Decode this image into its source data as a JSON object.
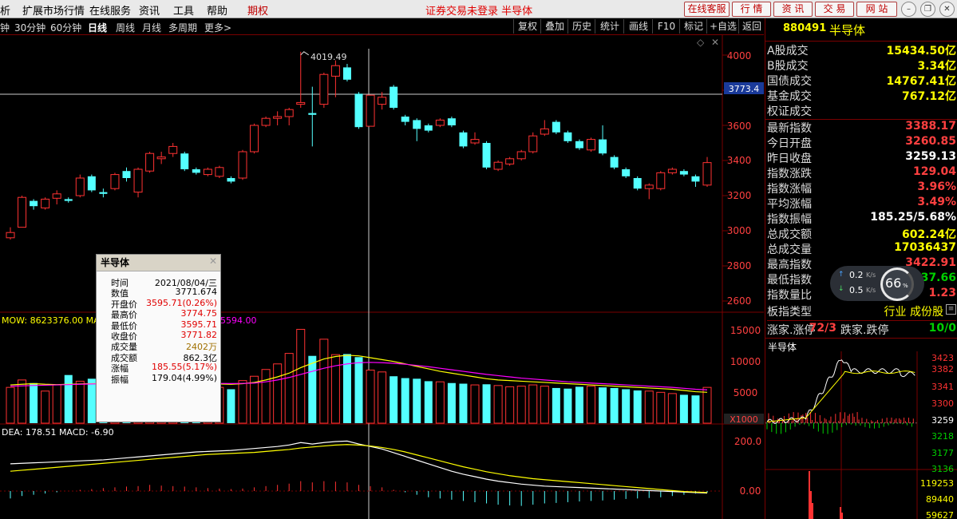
{
  "menu": {
    "items": [
      "析",
      "扩展市场行情",
      "在线服务",
      "资讯",
      "工具",
      "帮助",
      "期权"
    ],
    "status": "证券交易未登录 半导体",
    "buttons": [
      "在线客服",
      "行 情",
      "资 讯",
      "交 易",
      "网 站"
    ]
  },
  "periods": [
    "钟",
    "30分钟",
    "60分钟",
    "日线",
    "周线",
    "月线",
    "多周期",
    "更多>"
  ],
  "selected_period": "日线",
  "tools": [
    "复权",
    "叠加",
    "历史",
    "统计",
    "画线",
    "F10",
    "标记",
    "+自选",
    "返回"
  ],
  "chart": {
    "price_axis": [
      "4000",
      "3800",
      "3600",
      "3400",
      "3200",
      "3000",
      "2800",
      "2600"
    ],
    "crosshair_price": "3773.4",
    "high_marker": "4019.49",
    "vol_axis": [
      "15000",
      "10000",
      "5000"
    ],
    "vol_unit": "X1000",
    "vol_legend": "MOW: 8623376.00  MA",
    "vol_legend_tail": "5594.00",
    "macd_legend": "DEA: 178.51  MACD: -6.90",
    "macd_axis": [
      "200.0",
      "0.00"
    ],
    "colors": {
      "up": "#ff3232",
      "down": "#54ffff",
      "ma1": "#ffffff",
      "ma2": "#ffff00",
      "ma3": "#ff00ff"
    }
  },
  "chart_data": {
    "type": "candlestick",
    "title": "880491 半导体",
    "ylim": [
      2560,
      4080
    ],
    "candles": [
      {
        "o": 2960,
        "c": 2990,
        "h": 3020,
        "l": 2950
      },
      {
        "o": 3020,
        "c": 3190,
        "h": 3200,
        "l": 3020
      },
      {
        "o": 3170,
        "c": 3140,
        "h": 3180,
        "l": 3120
      },
      {
        "o": 3130,
        "c": 3180,
        "h": 3190,
        "l": 3120
      },
      {
        "o": 3185,
        "c": 3210,
        "h": 3230,
        "l": 3150
      },
      {
        "o": 3180,
        "c": 3170,
        "h": 3190,
        "l": 3160
      },
      {
        "o": 3200,
        "c": 3300,
        "h": 3320,
        "l": 3190
      },
      {
        "o": 3310,
        "c": 3230,
        "h": 3320,
        "l": 3220
      },
      {
        "o": 3220,
        "c": 3210,
        "h": 3240,
        "l": 3190
      },
      {
        "o": 3240,
        "c": 3320,
        "h": 3330,
        "l": 3230
      },
      {
        "o": 3340,
        "c": 3300,
        "h": 3360,
        "l": 3280
      },
      {
        "o": 3220,
        "c": 3350,
        "h": 3360,
        "l": 3190
      },
      {
        "o": 3340,
        "c": 3440,
        "h": 3450,
        "l": 3330
      },
      {
        "o": 3410,
        "c": 3420,
        "h": 3450,
        "l": 3380
      },
      {
        "o": 3440,
        "c": 3480,
        "h": 3500,
        "l": 3420
      },
      {
        "o": 3440,
        "c": 3350,
        "h": 3450,
        "l": 3340
      },
      {
        "o": 3350,
        "c": 3330,
        "h": 3360,
        "l": 3320
      },
      {
        "o": 3320,
        "c": 3350,
        "h": 3360,
        "l": 3310
      },
      {
        "o": 3310,
        "c": 3360,
        "h": 3370,
        "l": 3300
      },
      {
        "o": 3300,
        "c": 3280,
        "h": 3310,
        "l": 3270
      },
      {
        "o": 3300,
        "c": 3450,
        "h": 3460,
        "l": 3290
      },
      {
        "o": 3450,
        "c": 3600,
        "h": 3610,
        "l": 3440
      },
      {
        "o": 3600,
        "c": 3640,
        "h": 3650,
        "l": 3590
      },
      {
        "o": 3640,
        "c": 3650,
        "h": 3680,
        "l": 3600
      },
      {
        "o": 3650,
        "c": 3690,
        "h": 3700,
        "l": 3600
      },
      {
        "o": 3720,
        "c": 3730,
        "h": 4019,
        "l": 3700
      },
      {
        "o": 3670,
        "c": 3660,
        "h": 3820,
        "l": 3480
      },
      {
        "o": 3720,
        "c": 3890,
        "h": 3900,
        "l": 3700
      },
      {
        "o": 3880,
        "c": 3940,
        "h": 3970,
        "l": 3760
      },
      {
        "o": 3930,
        "c": 3860,
        "h": 3950,
        "l": 3850
      },
      {
        "o": 3780,
        "c": 3590,
        "h": 3790,
        "l": 3580
      },
      {
        "o": 3595,
        "c": 3772,
        "h": 3775,
        "l": 3596
      },
      {
        "o": 3720,
        "c": 3760,
        "h": 3790,
        "l": 3690
      },
      {
        "o": 3820,
        "c": 3700,
        "h": 3830,
        "l": 3690
      },
      {
        "o": 3650,
        "c": 3620,
        "h": 3660,
        "l": 3600
      },
      {
        "o": 3630,
        "c": 3580,
        "h": 3640,
        "l": 3510
      },
      {
        "o": 3600,
        "c": 3570,
        "h": 3610,
        "l": 3560
      },
      {
        "o": 3600,
        "c": 3630,
        "h": 3640,
        "l": 3590
      },
      {
        "o": 3640,
        "c": 3600,
        "h": 3650,
        "l": 3590
      },
      {
        "o": 3560,
        "c": 3480,
        "h": 3570,
        "l": 3470
      },
      {
        "o": 3500,
        "c": 3520,
        "h": 3560,
        "l": 3490
      },
      {
        "o": 3500,
        "c": 3360,
        "h": 3510,
        "l": 3350
      },
      {
        "o": 3350,
        "c": 3390,
        "h": 3400,
        "l": 3340
      },
      {
        "o": 3380,
        "c": 3410,
        "h": 3420,
        "l": 3370
      },
      {
        "o": 3410,
        "c": 3450,
        "h": 3460,
        "l": 3400
      },
      {
        "o": 3450,
        "c": 3540,
        "h": 3560,
        "l": 3440
      },
      {
        "o": 3550,
        "c": 3580,
        "h": 3630,
        "l": 3540
      },
      {
        "o": 3620,
        "c": 3560,
        "h": 3630,
        "l": 3550
      },
      {
        "o": 3560,
        "c": 3510,
        "h": 3570,
        "l": 3500
      },
      {
        "o": 3510,
        "c": 3470,
        "h": 3520,
        "l": 3460
      },
      {
        "o": 3460,
        "c": 3520,
        "h": 3530,
        "l": 3450
      },
      {
        "o": 3520,
        "c": 3440,
        "h": 3600,
        "l": 3430
      },
      {
        "o": 3420,
        "c": 3360,
        "h": 3430,
        "l": 3350
      },
      {
        "o": 3350,
        "c": 3310,
        "h": 3360,
        "l": 3300
      },
      {
        "o": 3300,
        "c": 3240,
        "h": 3310,
        "l": 3230
      },
      {
        "o": 3240,
        "c": 3260,
        "h": 3270,
        "l": 3180
      },
      {
        "o": 3240,
        "c": 3330,
        "h": 3340,
        "l": 3230
      },
      {
        "o": 3330,
        "c": 3350,
        "h": 3360,
        "l": 3320
      },
      {
        "o": 3340,
        "c": 3320,
        "h": 3350,
        "l": 3310
      },
      {
        "o": 3310,
        "c": 3280,
        "h": 3320,
        "l": 3250
      },
      {
        "o": 3260,
        "c": 3388,
        "h": 3420,
        "l": 3250
      }
    ],
    "volumes": [
      5800,
      7000,
      6500,
      5200,
      6200,
      7800,
      6800,
      7200,
      6700,
      5400,
      6100,
      6500,
      7200,
      6400,
      7100,
      6100,
      6000,
      6200,
      5800,
      5500,
      6900,
      7600,
      8700,
      9600,
      11300,
      15200,
      10900,
      13600,
      11100,
      11200,
      10700,
      8600,
      8300,
      7600,
      7300,
      7200,
      6800,
      6700,
      6500,
      6400,
      6200,
      6300,
      6100,
      5900,
      6000,
      6200,
      6000,
      5700,
      5600,
      5900,
      6000,
      5800,
      5700,
      5500,
      5300,
      5200,
      5000,
      4800,
      4600,
      4500,
      5800
    ],
    "ma_vol": [
      6200,
      6300,
      6400,
      6300,
      6250,
      6300,
      6350,
      6400,
      6450,
      6400,
      6350,
      6350,
      6400,
      6450,
      6500,
      6500,
      6450,
      6400,
      6350,
      6300,
      6400,
      6600,
      7000,
      7500,
      8100,
      9000,
      9700,
      10400,
      10800,
      11000,
      10900,
      10600,
      10300,
      10000,
      9600,
      9200,
      8800,
      8400,
      8100,
      7800,
      7500,
      7200,
      7000,
      6900,
      6800,
      6700,
      6600,
      6500,
      6400,
      6300,
      6200,
      6100,
      6000,
      5900,
      5800,
      5700,
      5600,
      5500,
      5300,
      5100,
      5000
    ],
    "ma_vol2": [
      6000,
      6050,
      6100,
      6150,
      6200,
      6250,
      6300,
      6350,
      6400,
      6400,
      6400,
      6400,
      6420,
      6440,
      6460,
      6480,
      6480,
      6460,
      6440,
      6420,
      6440,
      6500,
      6700,
      7000,
      7400,
      7900,
      8400,
      8900,
      9300,
      9600,
      9800,
      9850,
      9800,
      9700,
      9550,
      9350,
      9150,
      8900,
      8650,
      8400,
      8150,
      7900,
      7700,
      7500,
      7300,
      7150,
      7000,
      6850,
      6700,
      6600,
      6500,
      6400,
      6300,
      6200,
      6100,
      6000,
      5900,
      5800,
      5650,
      5500,
      5400
    ],
    "macd": [
      -30,
      -20,
      -15,
      -10,
      -5,
      0,
      5,
      8,
      12,
      15,
      18,
      20,
      25,
      22,
      20,
      18,
      15,
      12,
      10,
      8,
      10,
      15,
      20,
      25,
      30,
      40,
      35,
      40,
      38,
      35,
      25,
      20,
      15,
      5,
      -5,
      -15,
      -25,
      -30,
      -35,
      -40,
      -45,
      -50,
      -55,
      -58,
      -60,
      -55,
      -50,
      -48,
      -45,
      -42,
      -40,
      -38,
      -35,
      -32,
      -30,
      -28,
      -25,
      -20,
      -15,
      -10,
      -6.9
    ],
    "dif": [
      110,
      112,
      114,
      116,
      118,
      120,
      122,
      124,
      126,
      130,
      134,
      138,
      142,
      146,
      150,
      154,
      158,
      160,
      162,
      164,
      168,
      172,
      176,
      180,
      186,
      196,
      190,
      196,
      200,
      202,
      190,
      180,
      170,
      155,
      140,
      125,
      110,
      95,
      80,
      68,
      58,
      48,
      40,
      34,
      28,
      24,
      20,
      18,
      16,
      14,
      12,
      10,
      8,
      6,
      4,
      2,
      0,
      -2,
      -4,
      -6,
      -8
    ],
    "dea": [
      80,
      84,
      88,
      92,
      96,
      100,
      104,
      108,
      112,
      116,
      120,
      124,
      128,
      132,
      136,
      140,
      144,
      148,
      150,
      152,
      154,
      156,
      160,
      164,
      168,
      174,
      178,
      182,
      186,
      188,
      186,
      182,
      176,
      168,
      158,
      146,
      134,
      122,
      110,
      98,
      88,
      78,
      70,
      62,
      56,
      50,
      46,
      42,
      38,
      34,
      30,
      26,
      22,
      18,
      14,
      10,
      6,
      2,
      -2,
      -4,
      -6
    ]
  },
  "tooltip": {
    "title": "半导体",
    "rows": [
      {
        "k": "时间",
        "v": "2021/08/04/三",
        "c": "#000000"
      },
      {
        "k": "数值",
        "v": "3771.674",
        "c": "#000000"
      },
      {
        "k": "开盘价",
        "v": "3595.71(0.26%)",
        "c": "#e00000"
      },
      {
        "k": "最高价",
        "v": "3774.75",
        "c": "#e00000"
      },
      {
        "k": "最低价",
        "v": "3595.71",
        "c": "#e00000"
      },
      {
        "k": "收盘价",
        "v": "3771.82",
        "c": "#e00000"
      },
      {
        "k": "成交量",
        "v": "2402万",
        "c": "#a07000"
      },
      {
        "k": "成交额",
        "v": "862.3亿",
        "c": "#000000"
      },
      {
        "k": "涨幅",
        "v": "185.55(5.17%)",
        "c": "#e00000"
      },
      {
        "k": "振幅",
        "v": "179.04(4.99%)",
        "c": "#000000"
      }
    ]
  },
  "panel": {
    "code": "880491",
    "name": "半导体",
    "rows": [
      {
        "label": "A股成交",
        "value": "15434.50亿",
        "color": "yellow"
      },
      {
        "label": "B股成交",
        "value": "3.34亿",
        "color": "yellow"
      },
      {
        "label": "国债成交",
        "value": "14767.41亿",
        "color": "yellow"
      },
      {
        "label": "基金成交",
        "value": "767.12亿",
        "color": "yellow"
      },
      {
        "label": "权证成交",
        "value": "",
        "color": "yellow"
      },
      {
        "label": "最新指数",
        "value": "3388.17",
        "color": "red"
      },
      {
        "label": "今日开盘",
        "value": "3260.85",
        "color": "red"
      },
      {
        "label": "昨日收盘",
        "value": "3259.13",
        "color": "white"
      },
      {
        "label": "指数涨跌",
        "value": "129.04",
        "color": "red"
      },
      {
        "label": "指数涨幅",
        "value": "3.96%",
        "color": "red"
      },
      {
        "label": "平均涨幅",
        "value": "3.49%",
        "color": "red"
      },
      {
        "label": "指数振幅",
        "value": "185.25/5.68%",
        "color": "white"
      },
      {
        "label": "总成交额",
        "value": "602.24亿",
        "color": "yellow"
      },
      {
        "label": "总成交量",
        "value": "17036437",
        "color": "yellow"
      },
      {
        "label": "最高指数",
        "value": "3422.91",
        "color": "red"
      },
      {
        "label": "最低指数",
        "value": "37.66",
        "color": "green"
      },
      {
        "label": "指数量比",
        "value": "1.23",
        "color": "red"
      }
    ],
    "type_label": "板指类型",
    "type_value": "行业 成份股",
    "zhangjia_label": "涨家.涨停",
    "zhangjia_value": "72/3",
    "diejia_label": "跌家.跌停",
    "diejia_value": "10/0",
    "mini_title": "半导体",
    "mini_axis_right": [
      "3423",
      "3382",
      "3341",
      "3300",
      "3259",
      "3218",
      "3177",
      "3136",
      "119253",
      "89440",
      "59627"
    ]
  },
  "speed": {
    "up": "0.2",
    "down": "0.5",
    "unit": "K/s",
    "pct": "66"
  }
}
